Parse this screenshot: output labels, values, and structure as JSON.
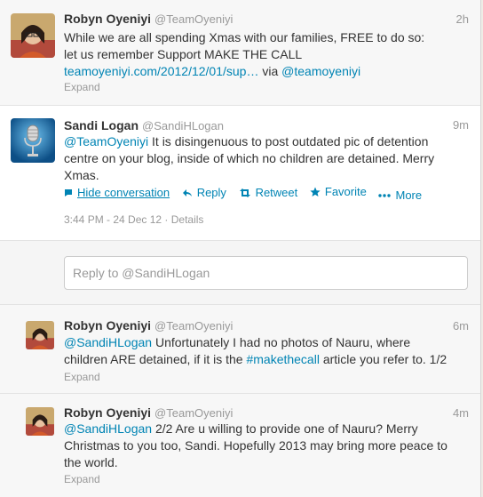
{
  "tweets": [
    {
      "name": "Robyn Oyeniyi",
      "handle": "@TeamOyeniyi",
      "time": "2h",
      "text_line1": "While we are all spending Xmas with our families, FREE to do so:",
      "text_line2": "let us remember Support MAKE THE CALL",
      "link_url": "teamoyeniyi.com/2012/12/01/sup…",
      "via": " via ",
      "via_link": "@teamoyeniyi",
      "expand": "Expand"
    },
    {
      "name": "Sandi Logan",
      "handle": "@SandiHLogan",
      "time": "9m",
      "mention": "@TeamOyeniyi",
      "text_after_mention": " It is disingenuous to post outdated pic of detention",
      "text_line2": "centre on your blog, inside of which no children are detained. Merry",
      "text_line3": "Xmas.",
      "actions": {
        "hide": "Hide conversation",
        "reply": "Reply",
        "retweet": "Retweet",
        "favorite": "Favorite",
        "more": "More"
      },
      "timestamp": "3:44 PM - 24 Dec 12",
      "separator": " · ",
      "details": "Details"
    },
    {
      "name": "Robyn Oyeniyi",
      "handle": "@TeamOyeniyi",
      "time": "6m",
      "mention": "@SandiHLogan",
      "text_after_mention": " Unfortunately I had no photos of Nauru, where",
      "text_line2_a": "children ARE detained, if it is the ",
      "hashtag": "#makethecall",
      "text_line2_b": " article you refer to. 1/2",
      "expand": "Expand"
    },
    {
      "name": "Robyn Oyeniyi",
      "handle": "@TeamOyeniyi",
      "time": "4m",
      "mention": "@SandiHLogan",
      "text_after_mention": " 2/2 Are u willing to provide one of Nauru? Merry",
      "text_line2": "Christmas to you too, Sandi. Hopefully 2013 may bring more peace to",
      "text_line3": "the world.",
      "expand": "Expand"
    }
  ],
  "reply_box": {
    "placeholder": "Reply to @SandiHLogan"
  },
  "colors": {
    "link": "#0084b4",
    "muted": "#999999",
    "text": "#333333"
  }
}
